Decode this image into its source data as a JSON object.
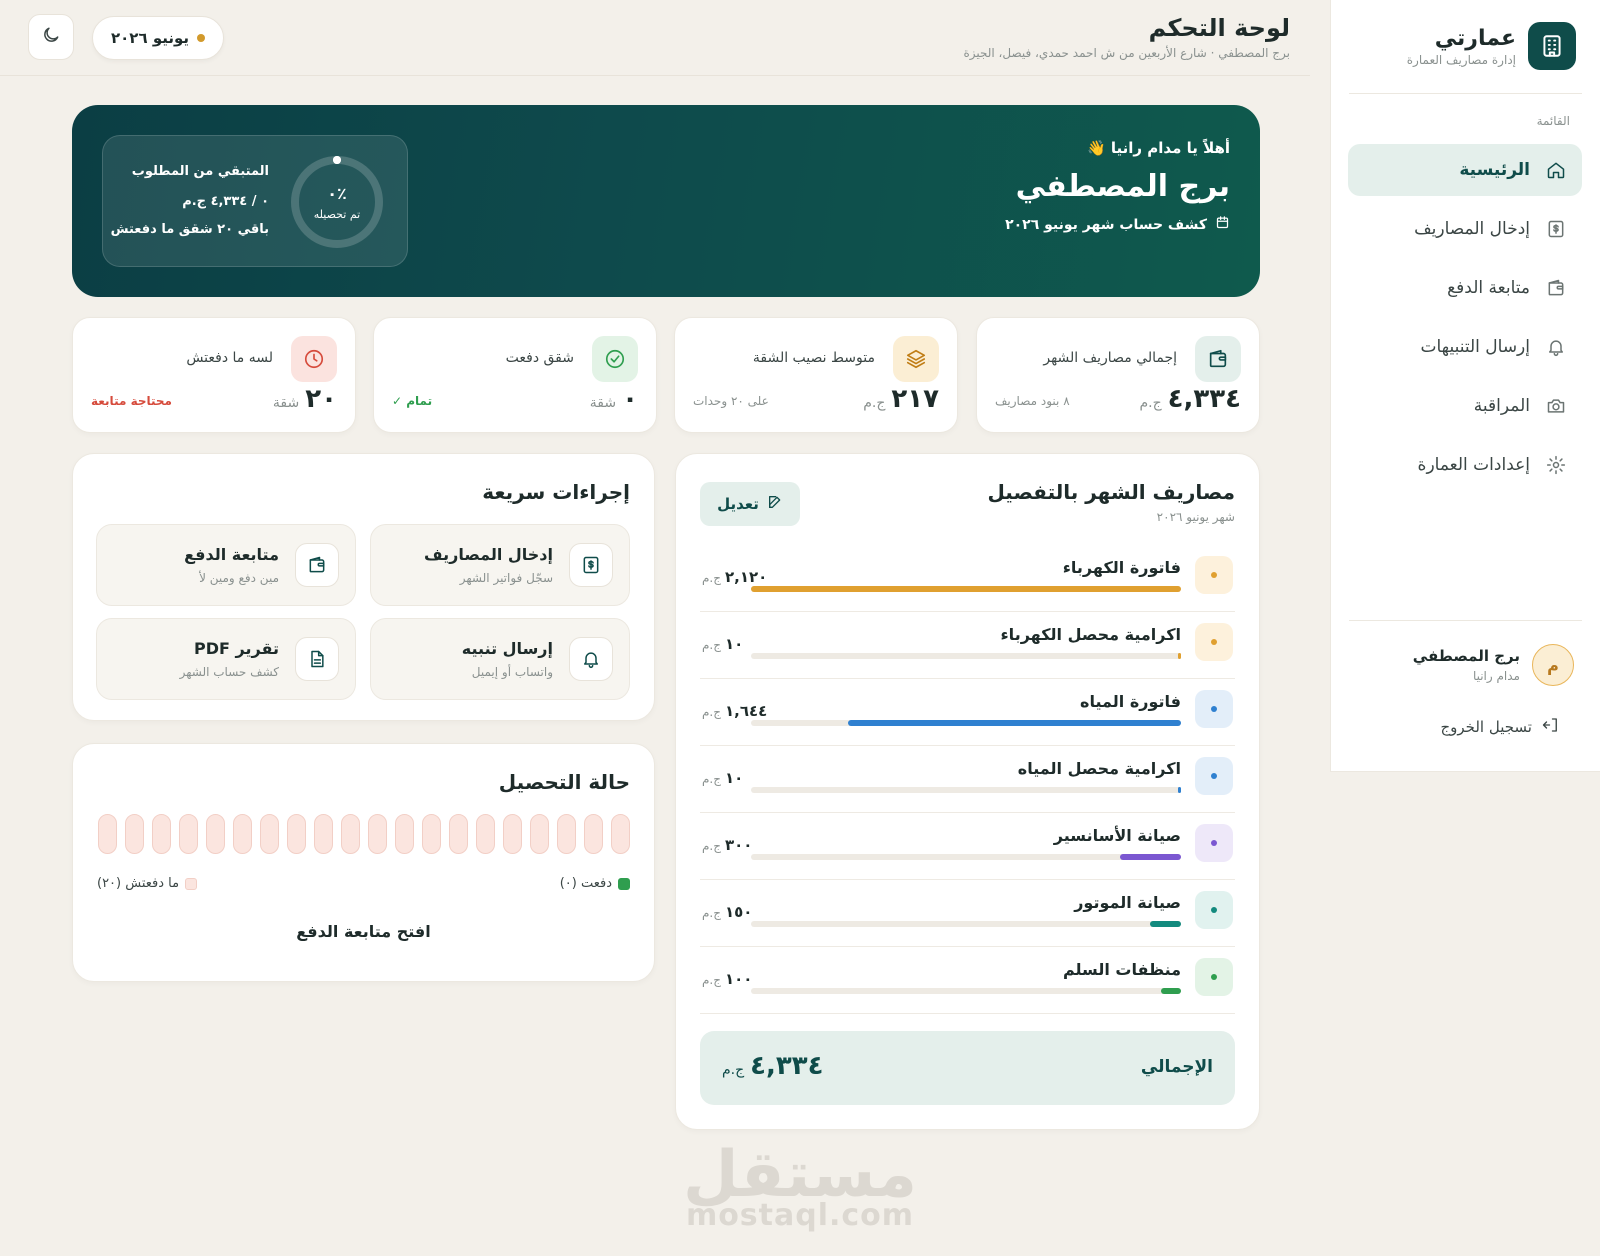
{
  "brand": {
    "name": "عمارتي",
    "subtitle": "إدارة مصاريف العمارة",
    "logo_icon": "building-icon"
  },
  "sidebar": {
    "section_label": "القائمة",
    "items": [
      {
        "label": "الرئيسية",
        "icon": "home-icon",
        "active": true
      },
      {
        "label": "إدخال المصاريف",
        "icon": "receipt-icon",
        "active": false
      },
      {
        "label": "متابعة الدفع",
        "icon": "wallet-icon",
        "active": false
      },
      {
        "label": "إرسال التنبيهات",
        "icon": "bell-icon",
        "active": false
      },
      {
        "label": "المراقبة",
        "icon": "camera-icon",
        "active": false
      },
      {
        "label": "إعدادات العمارة",
        "icon": "gear-icon",
        "active": false
      }
    ],
    "user": {
      "initial": "م",
      "name": "برج المصطفي",
      "role": "مدام رانيا"
    },
    "logout_label": "تسجيل الخروج"
  },
  "header": {
    "title": "لوحة التحكم",
    "subtitle": "برج المصطفي · شارع الأربعين من ش احمد حمدي، فيصل، الجيزة",
    "month": "يونيو ٢٠٢٦"
  },
  "hero": {
    "greeting": "أهلاً يا مدام رانيا 👋",
    "building": "برج المصطفي",
    "period": "كشف حساب شهر يونيو ٢٠٢٦",
    "collected_pct": 0,
    "collected_label": "٪٠",
    "collected_caption": "تم تحصيله",
    "remaining_title": "المتبقي من المطلوب",
    "remaining_amount": "٠ / ٤,٣٣٤ ج.م",
    "remaining_units": "باقي ٢٠ شقق ما دفعتش"
  },
  "stats": [
    {
      "label": "إجمالي مصاريف الشهر",
      "value": "٤,٣٣٤",
      "unit": "ج.م",
      "note": "٨ بنود مصاريف",
      "icon": "wallet-icon",
      "bg": "#e4efeb",
      "fg": "#0f4c4a",
      "note_color": "#8a918f"
    },
    {
      "label": "متوسط نصيب الشقة",
      "value": "٢١٧",
      "unit": "ج.م",
      "note": "على ٢٠ وحدات",
      "icon": "layers-icon",
      "bg": "#fbeed4",
      "fg": "#c07d15",
      "note_color": "#8a918f"
    },
    {
      "label": "شقق دفعت",
      "value": "٠",
      "unit": "شقة",
      "note": "تمام ✓",
      "icon": "check-circle-icon",
      "bg": "#e3f3e6",
      "fg": "#2f9e4f",
      "note_color": "#2f9e4f"
    },
    {
      "label": "لسه ما دفعتش",
      "value": "٢٠",
      "unit": "شقة",
      "note": "محتاجة متابعة",
      "icon": "clock-icon",
      "bg": "#fbe3df",
      "fg": "#d64b3c",
      "note_color": "#d64b3c"
    }
  ],
  "expenses": {
    "title": "مصاريف الشهر بالتفصيل",
    "subtitle": "شهر يونيو ٢٠٢٦",
    "edit_label": "تعديل",
    "currency": "ج.م",
    "items": [
      {
        "name": "فاتورة الكهرباء",
        "amount": "٢,١٢٠",
        "share": 1.0,
        "color": "#e0a030",
        "dot_bg": "#fdf1dc"
      },
      {
        "name": "اكرامية محصل الكهرباء",
        "amount": "١٠",
        "share": 0.005,
        "color": "#e0a030",
        "dot_bg": "#fdf1dc"
      },
      {
        "name": "فاتورة المياه",
        "amount": "١,٦٤٤",
        "share": 0.775,
        "color": "#2f80d0",
        "dot_bg": "#e3eef9"
      },
      {
        "name": "اكرامية محصل المياه",
        "amount": "١٠",
        "share": 0.005,
        "color": "#2f80d0",
        "dot_bg": "#e3eef9"
      },
      {
        "name": "صيانة الأسانسير",
        "amount": "٣٠٠",
        "share": 0.142,
        "color": "#7b57d1",
        "dot_bg": "#eee8f9"
      },
      {
        "name": "صيانة الموتور",
        "amount": "١٥٠",
        "share": 0.071,
        "color": "#138a7e",
        "dot_bg": "#e1f2ef"
      },
      {
        "name": "منظفات السلم",
        "amount": "١٠٠",
        "share": 0.047,
        "color": "#2f9e4f",
        "dot_bg": "#e3f3e6"
      }
    ],
    "total_label": "الإجمالي",
    "total_value": "٤,٣٣٤"
  },
  "quick_actions": {
    "title": "إجراءات سريعة",
    "items": [
      {
        "title": "إدخال المصاريف",
        "sub": "سجّل فواتير الشهر",
        "icon": "receipt-icon"
      },
      {
        "title": "متابعة الدفع",
        "sub": "مين دفع ومين لأ",
        "icon": "wallet-icon"
      },
      {
        "title": "إرسال تنبيه",
        "sub": "واتساب أو إيميل",
        "icon": "bell-icon"
      },
      {
        "title": "تقرير PDF",
        "sub": "كشف حساب الشهر",
        "icon": "document-icon"
      }
    ]
  },
  "collection": {
    "title": "حالة التحصيل",
    "units_total": 20,
    "units_paid": 0,
    "paid_legend": "دفعت (٠)",
    "unpaid_legend": "ما دفعتش (٢٠)",
    "link": "افتح متابعة الدفع"
  },
  "watermark": {
    "arabic": "مستقل",
    "latin": "mostaql.com"
  }
}
